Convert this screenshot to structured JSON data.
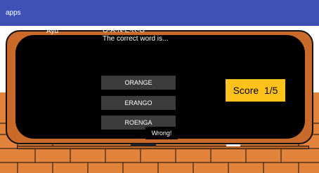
{
  "app": {
    "title": "apps"
  },
  "game": {
    "player": "Ayu",
    "scrambled": "O-A-N-E-R-G",
    "prompt": "The correct word is...",
    "options": [
      "ORANGE",
      "ERANGO",
      "ROENGA"
    ],
    "score_label": "Score",
    "score_value": "1/5",
    "result": "Wrong!"
  },
  "colors": {
    "appbar": "#3F51B5",
    "wall": "#E2833B",
    "frame": "#C96A2A",
    "board": "#000000",
    "score_bg": "#FFC21C",
    "button_bg": "#3B3B3B"
  }
}
